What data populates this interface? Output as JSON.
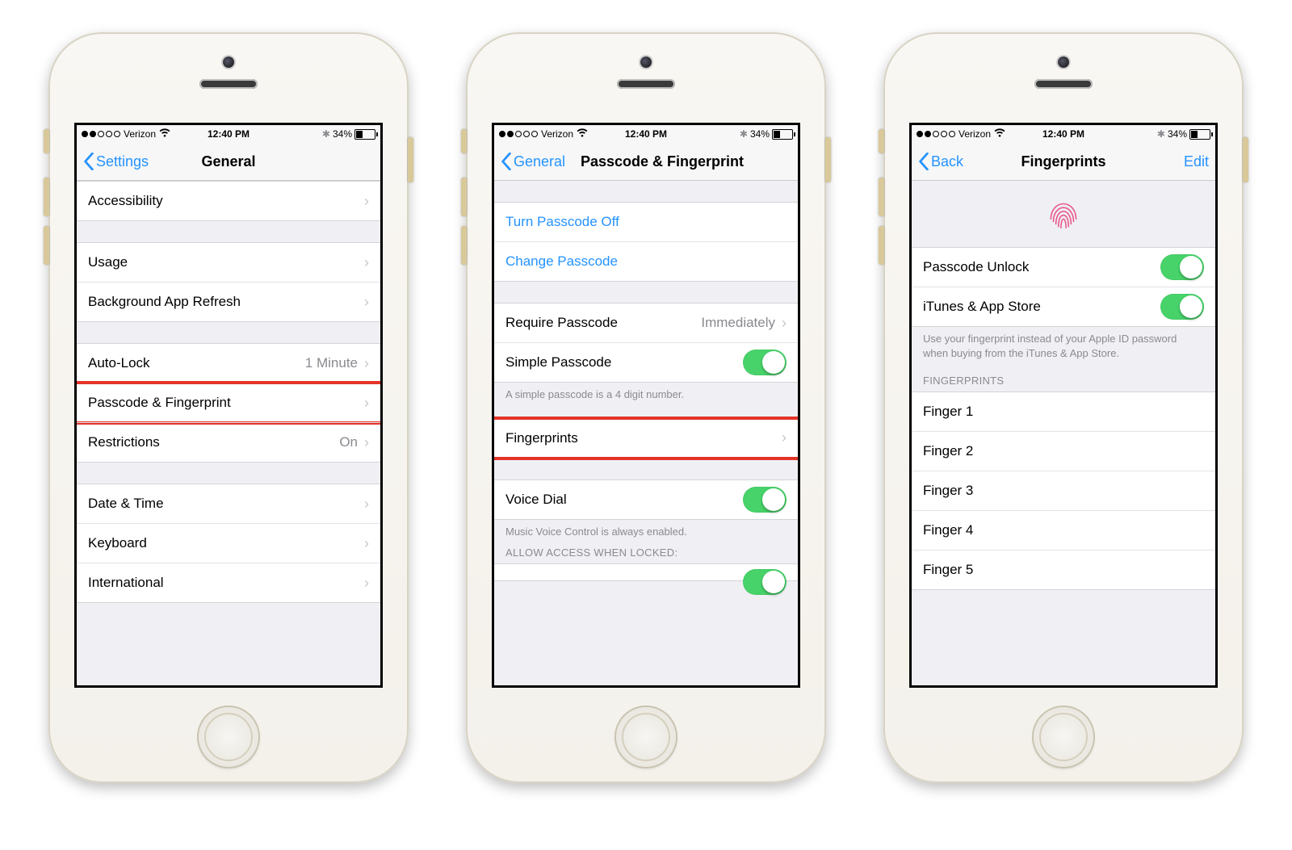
{
  "status": {
    "carrier": "Verizon",
    "time": "12:40 PM",
    "battery_pct": "34%"
  },
  "phone1": {
    "back": "Settings",
    "title": "General",
    "g1": [
      {
        "label": "Accessibility"
      }
    ],
    "g2": [
      {
        "label": "Usage"
      },
      {
        "label": "Background App Refresh"
      }
    ],
    "g3": [
      {
        "label": "Auto-Lock",
        "value": "1 Minute"
      },
      {
        "label": "Passcode & Fingerprint",
        "highlight": true
      },
      {
        "label": "Restrictions",
        "value": "On"
      }
    ],
    "g4": [
      {
        "label": "Date & Time"
      },
      {
        "label": "Keyboard"
      },
      {
        "label": "International"
      }
    ]
  },
  "phone2": {
    "back": "General",
    "title": "Passcode & Fingerprint",
    "links": [
      "Turn Passcode Off",
      "Change Passcode"
    ],
    "require": {
      "label": "Require Passcode",
      "value": "Immediately"
    },
    "simple": {
      "label": "Simple Passcode",
      "footer": "A simple passcode is a 4 digit number."
    },
    "fingerprints": {
      "label": "Fingerprints",
      "highlight": true
    },
    "voice": {
      "label": "Voice Dial",
      "footer": "Music Voice Control is always enabled."
    },
    "allow_header": "ALLOW ACCESS WHEN LOCKED:"
  },
  "phone3": {
    "back": "Back",
    "title": "Fingerprints",
    "edit": "Edit",
    "toggles": [
      {
        "label": "Passcode Unlock"
      },
      {
        "label": "iTunes & App Store"
      }
    ],
    "toggles_footer": "Use your fingerprint instead of your Apple ID password when buying from the iTunes & App Store.",
    "fp_header": "FINGERPRINTS",
    "fingers": [
      "Finger 1",
      "Finger 2",
      "Finger 3",
      "Finger 4",
      "Finger 5"
    ]
  }
}
